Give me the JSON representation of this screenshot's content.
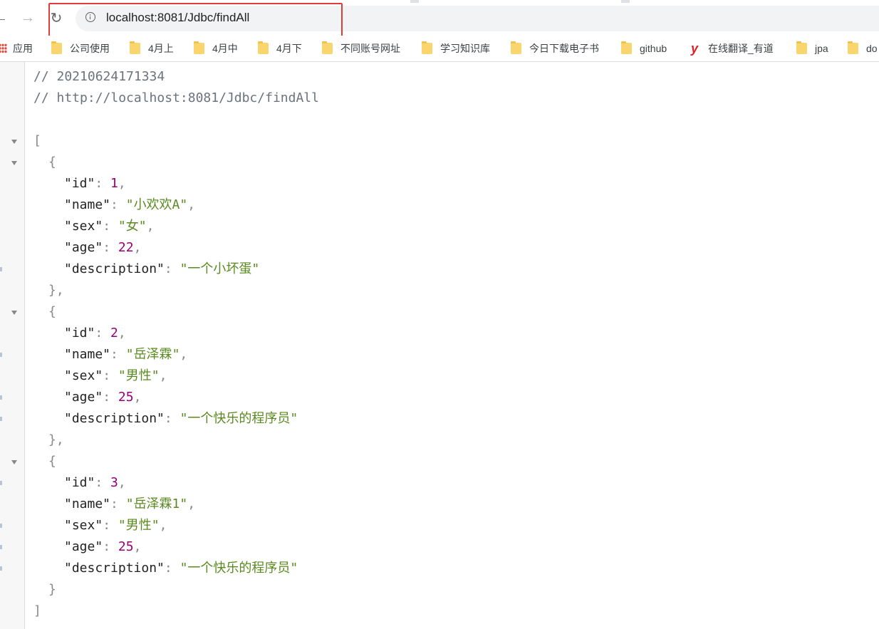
{
  "browser": {
    "url": "localhost:8081/Jdbc/findAll",
    "nav": {
      "back_glyph": "←",
      "forward_glyph": "→",
      "reload_glyph": "↻"
    },
    "highlight_color": "#e33b3b"
  },
  "bookmarks": {
    "items": [
      {
        "label": "应用",
        "icon": "apps-grid-icon"
      },
      {
        "label": "公司使用",
        "icon": "folder-icon"
      },
      {
        "label": "4月上",
        "icon": "folder-icon"
      },
      {
        "label": "4月中",
        "icon": "folder-icon"
      },
      {
        "label": "4月下",
        "icon": "folder-icon"
      },
      {
        "label": "不同账号网址",
        "icon": "folder-icon"
      },
      {
        "label": "学习知识库",
        "icon": "folder-icon"
      },
      {
        "label": "今日下载电子书",
        "icon": "folder-icon"
      },
      {
        "label": "github",
        "icon": "folder-icon"
      },
      {
        "label": "在线翻译_有道",
        "icon": "youdao-icon"
      },
      {
        "label": "jpa",
        "icon": "folder-icon"
      },
      {
        "label": "do",
        "icon": "folder-icon"
      }
    ],
    "youdao_glyph": "y"
  },
  "json_view": {
    "comments": [
      "// 20210624171334",
      "// http://localhost:8081/Jdbc/findAll"
    ],
    "records": [
      {
        "id": 1,
        "name": "小欢欢A",
        "sex": "女",
        "age": 22,
        "description": "一个小坏蛋"
      },
      {
        "id": 2,
        "name": "岳泽霖",
        "sex": "男性",
        "age": 25,
        "description": "一个快乐的程序员"
      },
      {
        "id": 3,
        "name": "岳泽霖1",
        "sex": "男性",
        "age": 25,
        "description": "一个快乐的程序员"
      }
    ],
    "colors": {
      "string": "#5a8a1f",
      "number": "#990073",
      "key": "#222222",
      "comment": "#6a737d"
    }
  }
}
